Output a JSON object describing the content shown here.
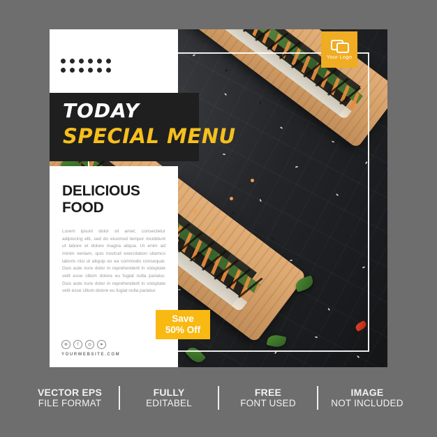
{
  "poster": {
    "kicker": "TODAY",
    "title": "SPECIAL MENU",
    "headline": "DELICIOUS FOOD",
    "body": "Lorem ipsum dolor sit amet, consectetur adipiscing elit, sed do eiusmod tempor incididunt ut labore et dolore magna aliqua. Ut enim ad minim veniam, quis nostrud exercitation ullamco laboris nisi ut aliquip ex ea commodo consequat. Duis aute irure dolor in reprehenderit in voluptate velit esse cillum dolore eu fugiat nulla pariatur. Duis aute irure dolor in reprehenderit in voluptate velit esse cillum dolore eu fugiat nulla pariatur.",
    "website": "YOURWEBSITE.COM",
    "badge": {
      "line1": "Save",
      "line2": "50% Off"
    },
    "logo": {
      "label": "Your Logo",
      "icon": "overlapping-rectangles-icon"
    },
    "social": [
      {
        "name": "globe-icon",
        "glyph": "⊕"
      },
      {
        "name": "facebook-icon",
        "glyph": "f"
      },
      {
        "name": "instagram-icon",
        "glyph": "◎"
      },
      {
        "name": "telegram-icon",
        "glyph": "➤"
      }
    ]
  },
  "colors": {
    "accent_yellow": "#f6bf1c",
    "badge_yellow": "#f9b913",
    "logo_yellow": "#f0ac22",
    "band_black": "#1f1f1f",
    "panel_white": "#ffffff",
    "page_gray": "#6e6e6e",
    "body_text_gray": "#9a9a9a"
  },
  "features": [
    {
      "t1": "VECTOR EPS",
      "t2": "FILE FORMAT"
    },
    {
      "t1": "FULLY",
      "t2": "EDITABEL"
    },
    {
      "t1": "FREE",
      "t2": "FONT USED"
    },
    {
      "t1": "IMAGE",
      "t2": "NOT INCLUDED"
    }
  ]
}
